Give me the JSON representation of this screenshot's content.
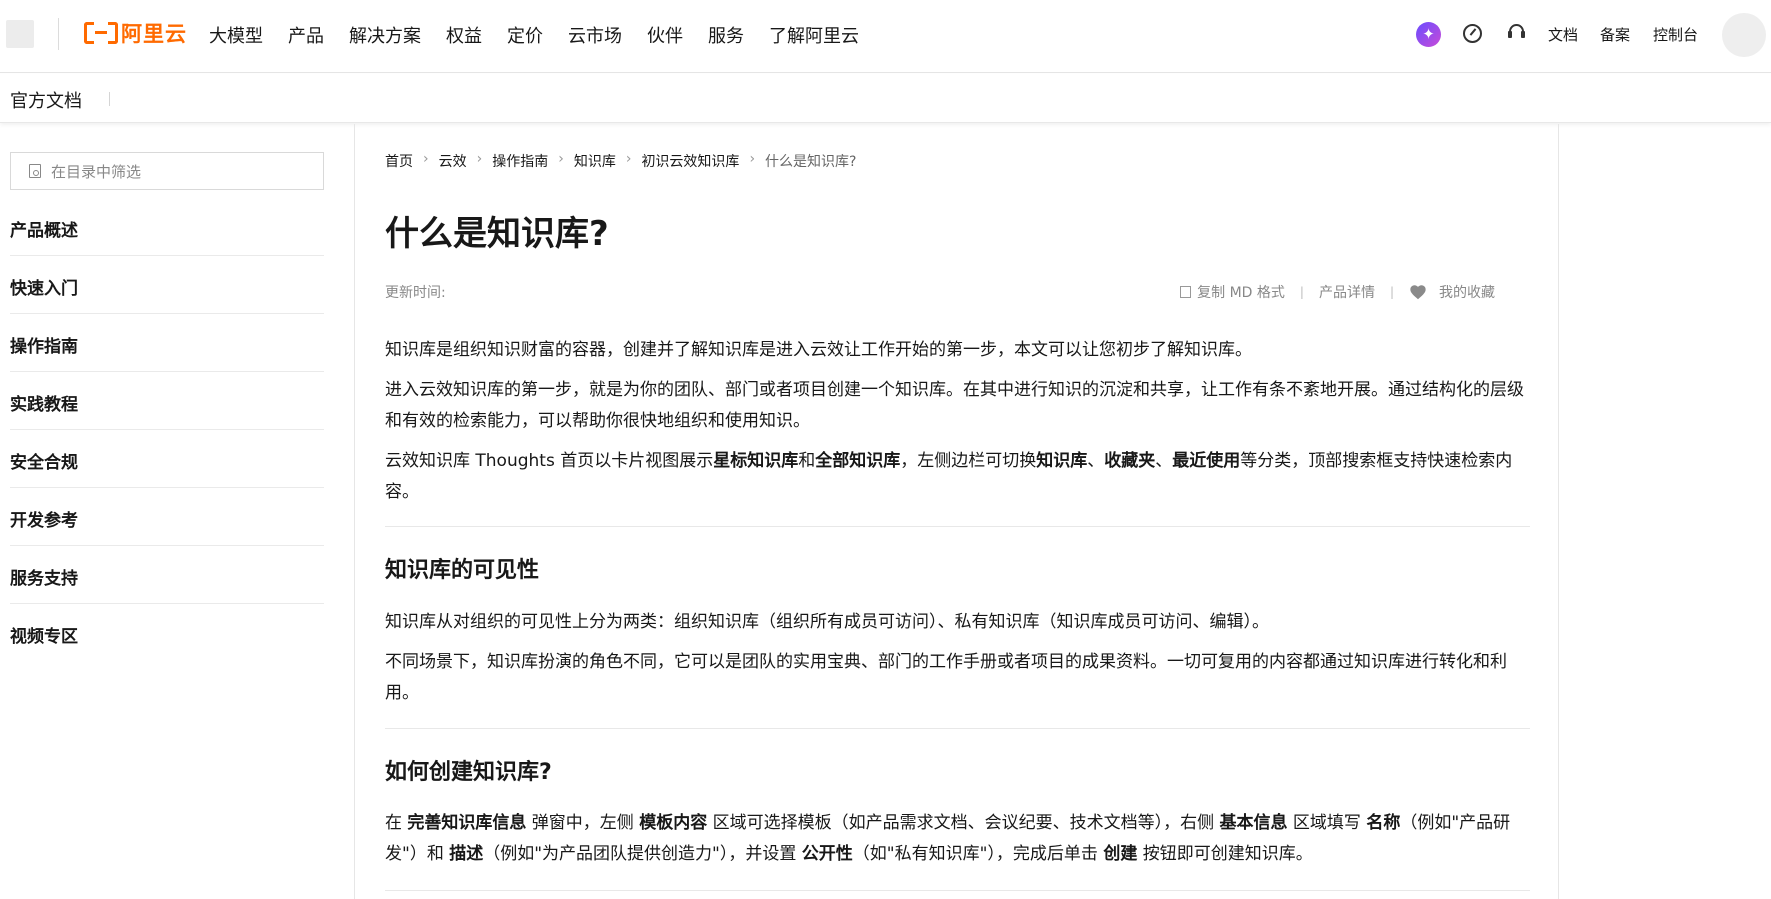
{
  "header": {
    "logo_text": "阿里云",
    "nav_items": [
      "大模型",
      "产品",
      "解决方案",
      "权益",
      "定价",
      "云市场",
      "伙伴",
      "服务",
      "了解阿里云"
    ],
    "right_links": {
      "docs": "文档",
      "filing": "备案",
      "console": "控制台"
    },
    "icons": [
      "ai-assistant-icon",
      "gauge-icon",
      "headset-icon"
    ],
    "brand_color": "#ff6a00"
  },
  "subheader": {
    "title": "官方文档"
  },
  "sidebar": {
    "filter_placeholder": "在目录中筛选",
    "items": [
      "产品概述",
      "快速入门",
      "操作指南",
      "实践教程",
      "安全合规",
      "开发参考",
      "服务支持",
      "视频专区"
    ]
  },
  "breadcrumb": [
    "首页",
    "云效",
    "操作指南",
    "知识库",
    "初识云效知识库",
    "什么是知识库?"
  ],
  "article": {
    "title": "什么是知识库?",
    "updated_label": "更新时间:",
    "actions": {
      "copy_md": "复制 MD 格式",
      "product_detail": "产品详情",
      "favorite": "我的收藏"
    },
    "p1": "知识库是组织知识财富的容器，创建并了解知识库是进入云效让工作开始的第一步，本文可以让您初步了解知识库。",
    "p2": "进入云效知识库的第一步，就是为你的团队、部门或者项目创建一个知识库。在其中进行知识的沉淀和共享，让工作有条不紊地开展。通过结构化的层级和有效的检索能力，可以帮助你很快地组织和使用知识。",
    "p3": {
      "t1": "云效知识库 Thoughts 首页以卡片视图展示",
      "b1": "星标知识库",
      "t2": "和",
      "b2": "全部知识库",
      "t3": "，左侧边栏可切换",
      "b3": "知识库",
      "t4": "、",
      "b4": "收藏夹",
      "t5": "、",
      "b5": "最近使用",
      "t6": "等分类，顶部搜索框支持快速检索内容。"
    },
    "h2_visibility": "知识库的可见性",
    "p4": "知识库从对组织的可见性上分为两类：组织知识库（组织所有成员可访问）、私有知识库（知识库成员可访问、编辑）。",
    "p5": "不同场景下，知识库扮演的角色不同，它可以是团队的实用宝典、部门的工作手册或者项目的成果资料。一切可复用的内容都通过知识库进行转化和利用。",
    "h2_create": "如何创建知识库?",
    "p6": {
      "t1": "在 ",
      "b1": "完善知识库信息",
      "t2": " 弹窗中，左侧 ",
      "b2": "模板内容",
      "t3": " 区域可选择模板（如产品需求文档、会议纪要、技术文档等），右侧 ",
      "b3": "基本信息",
      "t4": " 区域填写 ",
      "b4": "名称",
      "t5": "（例如\"产品研发\"）和 ",
      "b5": "描述",
      "t6": "（例如\"为产品团队提供创造力\"），并设置 ",
      "b6": "公开性",
      "t7": "（如\"私有知识库\"），完成后单击 ",
      "b7": "创建",
      "t8": " 按钮即可创建知识库。"
    }
  }
}
